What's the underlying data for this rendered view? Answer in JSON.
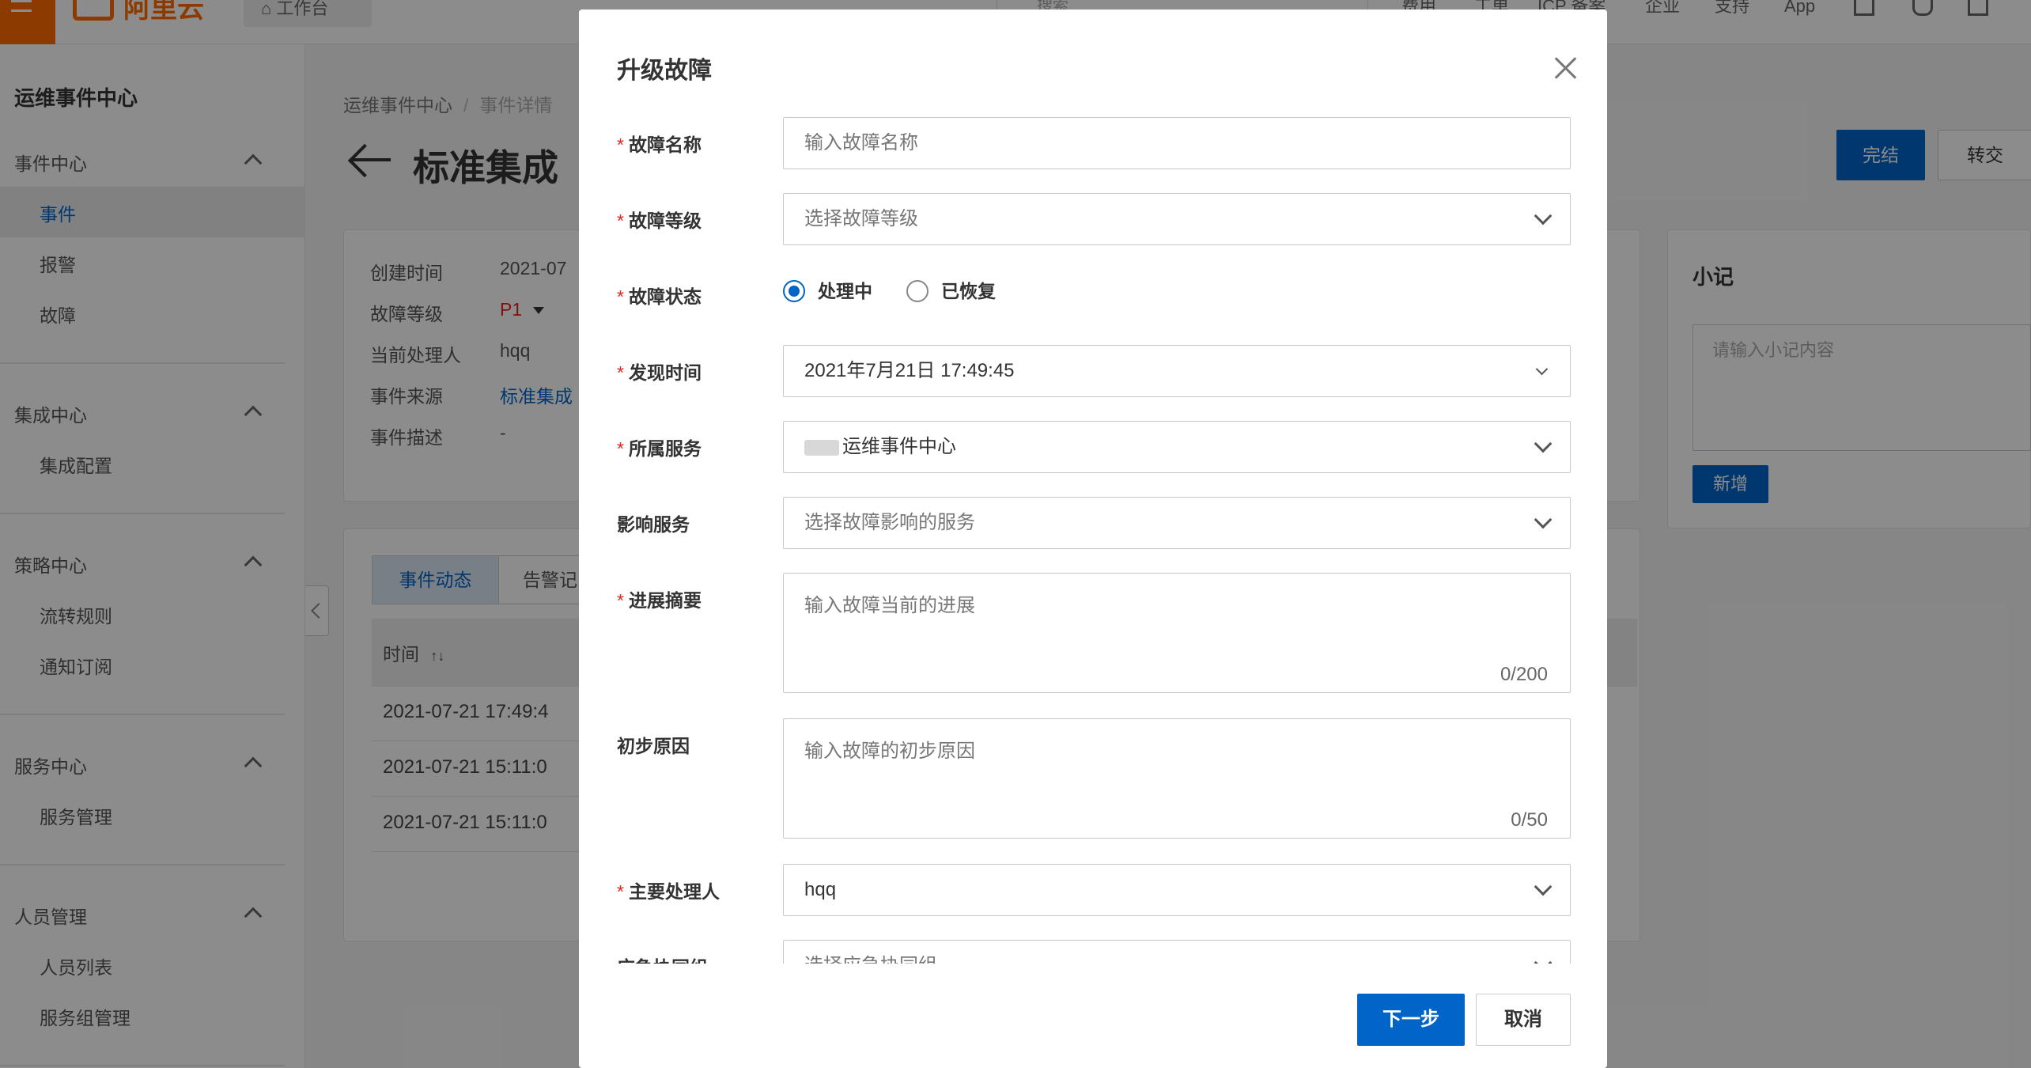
{
  "topbar": {
    "logo_text": "阿里云",
    "workbench_label": "工作台",
    "search_placeholder": "搜索",
    "nav": [
      "费用",
      "工单",
      "ICP 备案",
      "企业",
      "支持",
      "App"
    ]
  },
  "sidebar": {
    "title": "运维事件中心",
    "groups": [
      {
        "label": "事件中心",
        "items": [
          "事件",
          "报警",
          "故障"
        ]
      },
      {
        "label": "集成中心",
        "items": [
          "集成配置"
        ]
      },
      {
        "label": "策略中心",
        "items": [
          "流转规则",
          "通知订阅"
        ]
      },
      {
        "label": "服务中心",
        "items": [
          "服务管理"
        ]
      },
      {
        "label": "人员管理",
        "items": [
          "人员列表",
          "服务组管理"
        ]
      }
    ]
  },
  "main": {
    "breadcrumb": [
      "运维事件中心",
      "事件详情"
    ],
    "page_title": "标准集成",
    "finish_label": "完结",
    "transfer_label": "转交",
    "info": [
      {
        "label": "创建时间",
        "value": "2021-07"
      },
      {
        "label": "故障等级",
        "value": "P1"
      },
      {
        "label": "当前处理人",
        "value": "hqq"
      },
      {
        "label": "事件来源",
        "value": "标准集成"
      },
      {
        "label": "事件描述",
        "value": "-"
      }
    ],
    "tabs": [
      "事件动态",
      "告警记"
    ],
    "table_header": "时间",
    "sort_icon_text": "↑↓",
    "rows": [
      "2021-07-21 17:49:4",
      "2021-07-21 15:11:0",
      "2021-07-21 15:11:0"
    ],
    "note": {
      "title": "小记",
      "placeholder": "请输入小记内容",
      "add_label": "新增"
    }
  },
  "modal": {
    "title": "升级故障",
    "fields": {
      "name": {
        "label": "故障名称",
        "placeholder": "输入故障名称"
      },
      "level": {
        "label": "故障等级",
        "placeholder": "选择故障等级"
      },
      "status": {
        "label": "故障状态",
        "options": [
          "处理中",
          "已恢复"
        ],
        "selected": "处理中"
      },
      "found_time": {
        "label": "发现时间",
        "value": "2021年7月21日 17:49:45"
      },
      "service": {
        "label": "所属服务",
        "value": "运维事件中心"
      },
      "impact": {
        "label": "影响服务",
        "placeholder": "选择故障影响的服务"
      },
      "progress": {
        "label": "进展摘要",
        "placeholder": "输入故障当前的进展",
        "counter": "0/200"
      },
      "cause": {
        "label": "初步原因",
        "placeholder": "输入故障的初步原因",
        "counter": "0/50"
      },
      "owner": {
        "label": "主要处理人",
        "value": "hqq"
      },
      "group": {
        "label": "应急协同组",
        "placeholder": "选择应急协同组"
      }
    },
    "next_label": "下一步",
    "cancel_label": "取消"
  },
  "colors": {
    "primary": "#0064c8",
    "brand": "#ff6a00",
    "required": "#e0261b"
  }
}
